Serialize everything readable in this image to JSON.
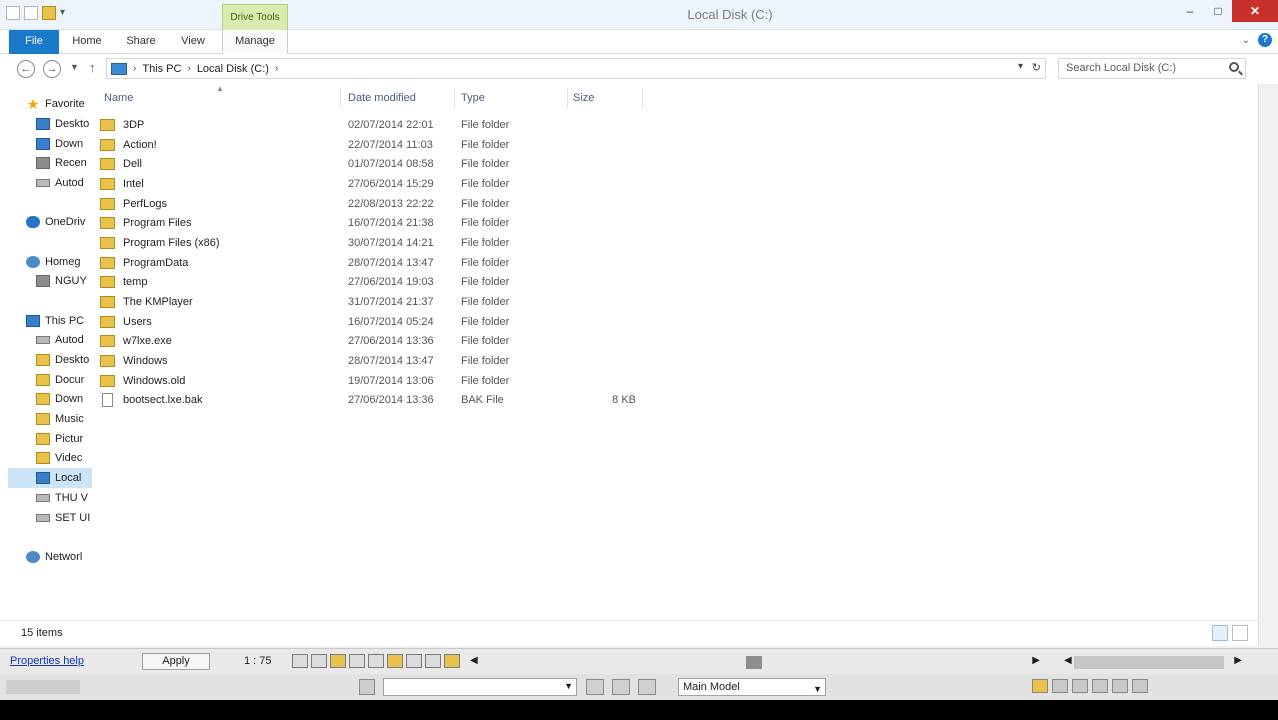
{
  "window": {
    "title": "Local Disk (C:)",
    "context_tab": "Drive Tools"
  },
  "ribbon": {
    "tabs": [
      "File",
      "Home",
      "Share",
      "View",
      "Manage"
    ]
  },
  "address": {
    "crumbs": [
      "This PC",
      "Local Disk (C:)"
    ],
    "search_placeholder": "Search Local Disk (C:)"
  },
  "nav": {
    "items": [
      {
        "label": "Favorites",
        "icon": "star-icon"
      },
      {
        "label": "Desktop",
        "icon": "desktop-icon"
      },
      {
        "label": "Downloads",
        "icon": "downloads-icon"
      },
      {
        "label": "Recent places",
        "icon": "recent-icon"
      },
      {
        "label": "Autodesk",
        "icon": "autodesk-icon"
      },
      {
        "label": "OneDrive",
        "icon": "onedrive-icon"
      },
      {
        "label": "Homegroup",
        "icon": "homegroup-icon"
      },
      {
        "label": "NGUY",
        "icon": "user-icon"
      },
      {
        "label": "This PC",
        "icon": "pc-icon"
      },
      {
        "label": "Autodesk",
        "icon": "autodesk-icon"
      },
      {
        "label": "Desktop",
        "icon": "desktop-icon"
      },
      {
        "label": "Documents",
        "icon": "documents-icon"
      },
      {
        "label": "Downloads",
        "icon": "downloads-icon"
      },
      {
        "label": "Music",
        "icon": "music-icon"
      },
      {
        "label": "Pictures",
        "icon": "pictures-icon"
      },
      {
        "label": "Videos",
        "icon": "videos-icon"
      },
      {
        "label": "Local Disk",
        "icon": "drive-icon"
      },
      {
        "label": "THU V",
        "icon": "drive-icon"
      },
      {
        "label": "SET UI",
        "icon": "drive-icon"
      },
      {
        "label": "Network",
        "icon": "network-icon"
      }
    ],
    "display": [
      "Favorite",
      "Deskto",
      "Down",
      "Recen",
      "Autod",
      "OneDriv",
      "Homeg",
      "NGUY",
      "This PC",
      "Autod",
      "Deskto",
      "Docur",
      "Down",
      "Music",
      "Pictur",
      "Videc",
      "Local",
      "THU V",
      "SET UI",
      "Networl"
    ]
  },
  "columns": {
    "name": "Name",
    "date": "Date modified",
    "type": "Type",
    "size": "Size"
  },
  "files": [
    {
      "name": "3DP",
      "date": "02/07/2014 22:01",
      "type": "File folder",
      "size": "",
      "kind": "folder"
    },
    {
      "name": "Action!",
      "date": "22/07/2014 11:03",
      "type": "File folder",
      "size": "",
      "kind": "folder"
    },
    {
      "name": "Dell",
      "date": "01/07/2014 08:58",
      "type": "File folder",
      "size": "",
      "kind": "folder"
    },
    {
      "name": "Intel",
      "date": "27/06/2014 15:29",
      "type": "File folder",
      "size": "",
      "kind": "folder"
    },
    {
      "name": "PerfLogs",
      "date": "22/08/2013 22:22",
      "type": "File folder",
      "size": "",
      "kind": "folder"
    },
    {
      "name": "Program Files",
      "date": "16/07/2014 21:38",
      "type": "File folder",
      "size": "",
      "kind": "folder"
    },
    {
      "name": "Program Files (x86)",
      "date": "30/07/2014 14:21",
      "type": "File folder",
      "size": "",
      "kind": "folder"
    },
    {
      "name": "ProgramData",
      "date": "28/07/2014 13:47",
      "type": "File folder",
      "size": "",
      "kind": "folder"
    },
    {
      "name": "temp",
      "date": "27/06/2014 19:03",
      "type": "File folder",
      "size": "",
      "kind": "folder"
    },
    {
      "name": "The KMPlayer",
      "date": "31/07/2014 21:37",
      "type": "File folder",
      "size": "",
      "kind": "folder"
    },
    {
      "name": "Users",
      "date": "16/07/2014 05:24",
      "type": "File folder",
      "size": "",
      "kind": "folder"
    },
    {
      "name": "w7lxe.exe",
      "date": "27/06/2014 13:36",
      "type": "File folder",
      "size": "",
      "kind": "folder"
    },
    {
      "name": "Windows",
      "date": "28/07/2014 13:47",
      "type": "File folder",
      "size": "",
      "kind": "folder"
    },
    {
      "name": "Windows.old",
      "date": "19/07/2014 13:06",
      "type": "File folder",
      "size": "",
      "kind": "folder"
    },
    {
      "name": "bootsect.lxe.bak",
      "date": "27/06/2014 13:36",
      "type": "BAK File",
      "size": "8 KB",
      "kind": "file"
    }
  ],
  "status": {
    "items_count": "15 items"
  },
  "autocad": {
    "properties_link": "Properties help",
    "apply_label": "Apply",
    "scale": "1 : 75",
    "model_value": "Main Model"
  }
}
